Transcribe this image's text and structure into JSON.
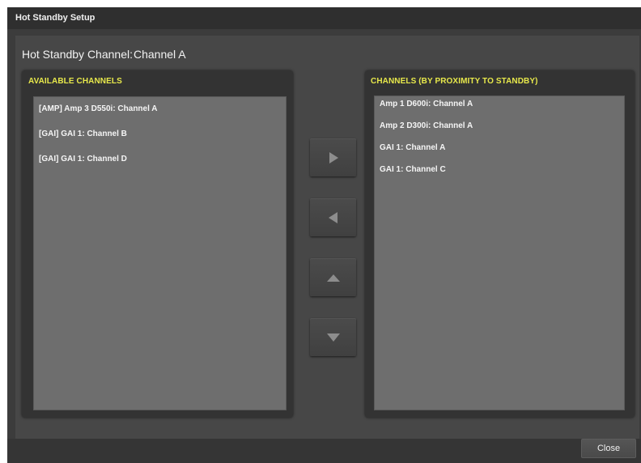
{
  "window": {
    "title": "Hot Standby Setup"
  },
  "hot_standby": {
    "label": "Hot Standby Channel:",
    "value": "Channel A"
  },
  "available": {
    "header": "AVAILABLE CHANNELS",
    "items": [
      "[AMP] Amp 3 D550i: Channel A",
      "[GAI] GAI 1: Channel B",
      "[GAI] GAI 1: Channel D"
    ]
  },
  "proximity": {
    "header": "CHANNELS (BY PROXIMITY TO STANDBY)",
    "items": [
      "Amp 1 D600i: Channel A",
      "Amp 2 D300i: Channel A",
      "GAI 1: Channel A",
      "GAI 1: Channel C"
    ]
  },
  "buttons": {
    "move_right_icon": "triangle-right-icon",
    "move_left_icon": "triangle-left-icon",
    "move_up_icon": "triangle-up-icon",
    "move_down_icon": "triangle-down-icon",
    "close_label": "Close"
  },
  "colors": {
    "header_accent": "#e7e84b",
    "list_background": "#6e6e6e",
    "panel_background": "#333333",
    "window_background": "#3c3c3c"
  }
}
